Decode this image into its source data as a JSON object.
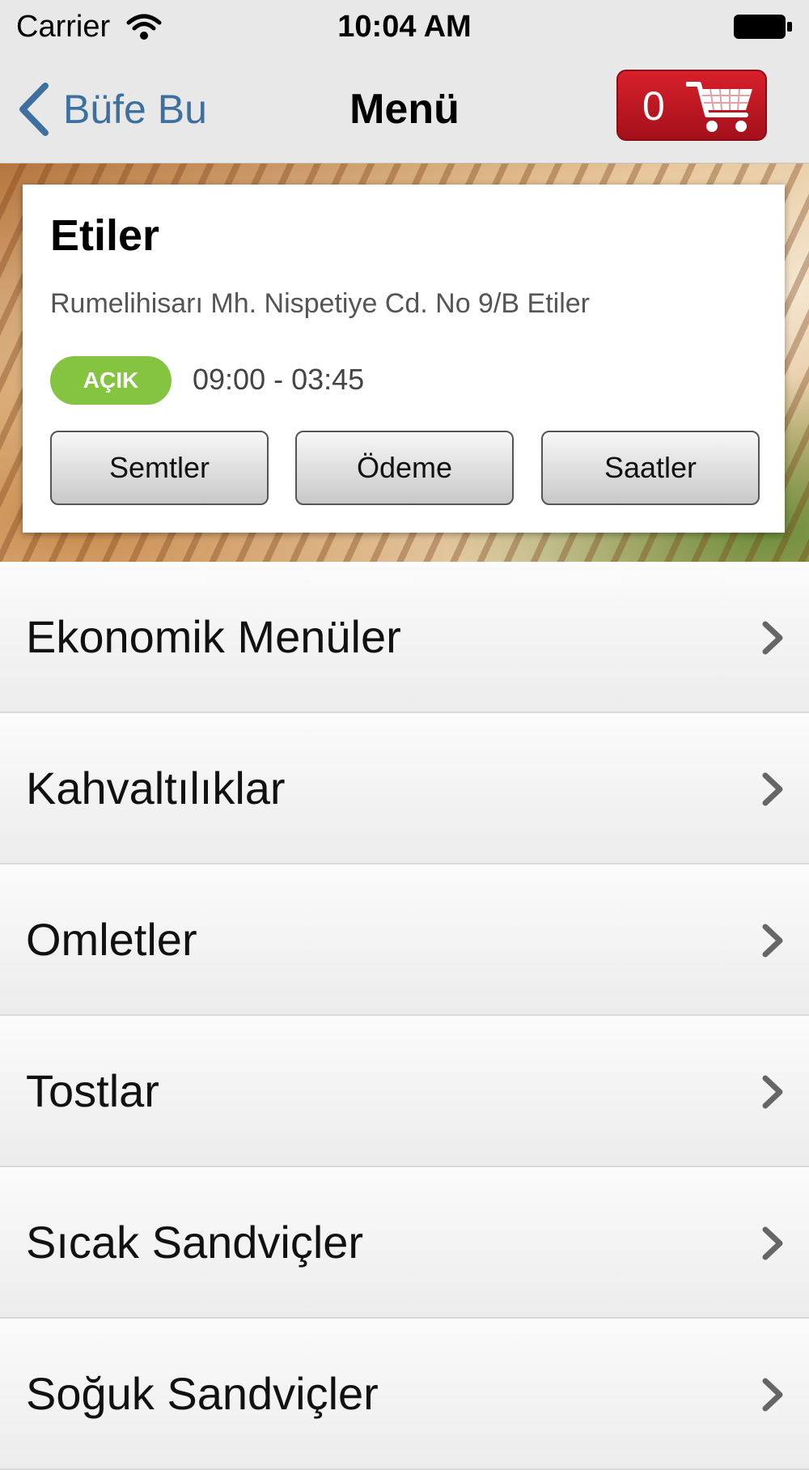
{
  "status_bar": {
    "carrier": "Carrier",
    "time": "10:04 AM"
  },
  "nav": {
    "back_label": "Büfe Bu",
    "title": "Menü",
    "cart_count": "0"
  },
  "branch": {
    "name": "Etiler",
    "address": "Rumelihisarı Mh. Nispetiye Cd. No 9/B Etiler",
    "status_badge": "AÇIK",
    "hours": "09:00 - 03:45",
    "buttons": {
      "semtler": "Semtler",
      "odeme": "Ödeme",
      "saatler": "Saatler"
    }
  },
  "menu": {
    "items": [
      {
        "label": "Ekonomik Menüler"
      },
      {
        "label": "Kahvaltılıklar"
      },
      {
        "label": "Omletler"
      },
      {
        "label": "Tostlar"
      },
      {
        "label": "Sıcak Sandviçler"
      },
      {
        "label": "Soğuk Sandviçler"
      }
    ]
  },
  "colors": {
    "nav_background": "#e8e8e8",
    "back_tint": "#3d6f9f",
    "cart_red": "#c8141f",
    "open_green": "#84c441"
  }
}
